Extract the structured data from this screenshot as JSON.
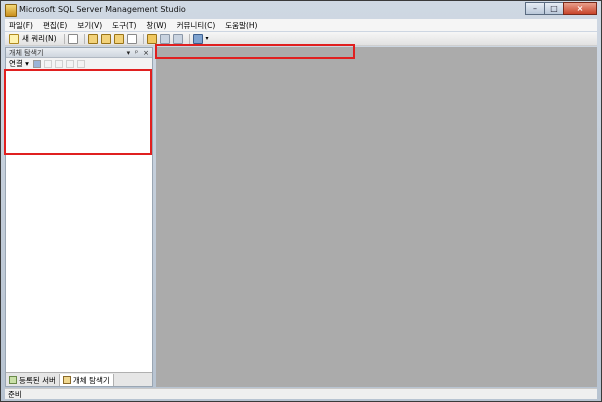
{
  "window": {
    "title": "Microsoft SQL Server Management Studio",
    "controls": {
      "minimize": "–",
      "maximize": "□",
      "close": "×"
    }
  },
  "menubar": {
    "items": [
      {
        "label": "파일(F)"
      },
      {
        "label": "편집(E)"
      },
      {
        "label": "보기(V)"
      },
      {
        "label": "도구(T)"
      },
      {
        "label": "창(W)"
      },
      {
        "label": "커뮤니티(C)"
      },
      {
        "label": "도움말(H)"
      }
    ]
  },
  "toolbar": {
    "new_query_label": "새 쿼리(N)"
  },
  "object_explorer": {
    "title": "개체 탐색기",
    "controls": {
      "dropdown": "▾",
      "pin": "ᵖ",
      "close": "×"
    },
    "connect_label": "연결 ▾"
  },
  "bottom_tabs": [
    {
      "label": "등록된 서버"
    },
    {
      "label": "개체 탐색기"
    }
  ],
  "status": {
    "text": "준비"
  },
  "colors": {
    "highlight": "#e02020",
    "mdi_background": "#ababab"
  }
}
